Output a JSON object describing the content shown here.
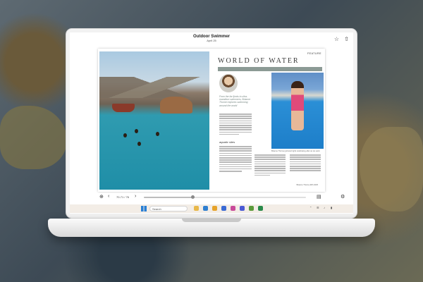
{
  "magazine": {
    "title": "Outdoor Swimmer",
    "date": "April 25"
  },
  "article": {
    "section_label": "FEATURE",
    "headline": "WORLD OF WATER",
    "pull_quote": "From the far fjords to ultra-marathon swimmers, Brianne Thorne explores swimming around the world",
    "subhead": "aquatic sites",
    "photo_caption": "Brianne Thorne (pictured right) celebrating after an ice swim",
    "credit": "Brianne Thorne (RP) 2025"
  },
  "reader": {
    "page_indicator": "70-71 / 76",
    "progress": 0.3
  },
  "taskbar": {
    "search_placeholder": "Search",
    "apps": [
      "file-explorer",
      "edge",
      "chrome",
      "store",
      "photos",
      "teams",
      "settings",
      "media"
    ],
    "app_colors": [
      "#e8b84a",
      "#2f7fd0",
      "#e6a32a",
      "#3a6ad4",
      "#c84a9a",
      "#4a5ad4",
      "#5a9a3a",
      "#2a8a4a"
    ]
  },
  "colors": {
    "headline_rule": "#8c9a95",
    "accent_blue": "#2a7fd4"
  }
}
